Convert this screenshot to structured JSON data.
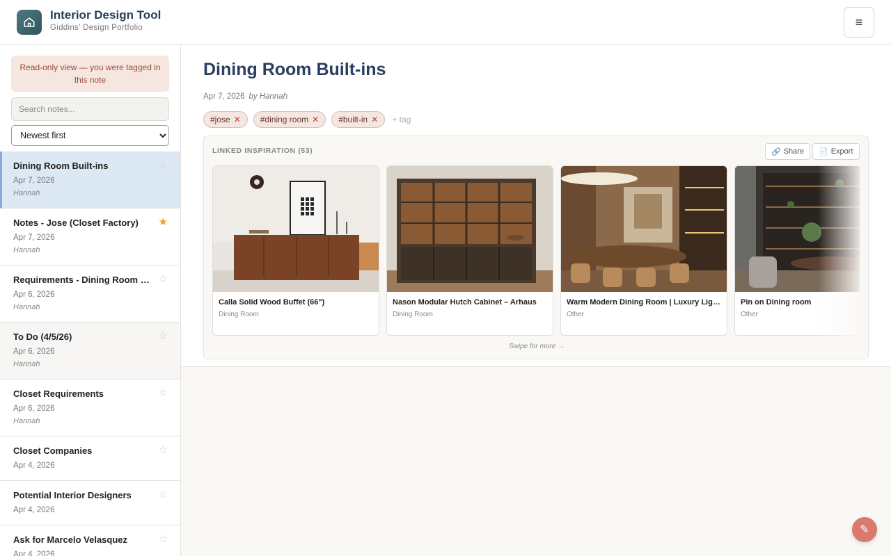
{
  "header": {
    "title": "Interior Design Tool",
    "subtitle": "Giddins' Design Portfolio",
    "logo_icon": "home-icon",
    "menu_icon": "hamburger-icon"
  },
  "sidebar": {
    "readonly_banner": "Read-only view — you were tagged in this note",
    "search_placeholder": "Search notes...",
    "sort": {
      "selected": "Newest first",
      "options": [
        "Newest first"
      ]
    },
    "notes": [
      {
        "title": "Dining Room Built-ins",
        "date": "Apr 7, 2026",
        "author": "Hannah",
        "starred": false,
        "selected": true
      },
      {
        "title": "Notes - Jose (Closet Factory)",
        "date": "Apr 7, 2026",
        "author": "Hannah",
        "starred": true,
        "selected": false
      },
      {
        "title": "Requirements - Dining Room Built-ins",
        "date": "Apr 6, 2026",
        "author": "Hannah",
        "starred": false,
        "selected": false
      },
      {
        "title": "To Do (4/5/26)",
        "date": "Apr 6, 2026",
        "author": "Hannah",
        "starred": false,
        "selected": false
      },
      {
        "title": "Closet Requirements",
        "date": "Apr 6, 2026",
        "author": "Hannah",
        "starred": false,
        "selected": false
      },
      {
        "title": "Closet Companies",
        "date": "Apr 4, 2026",
        "author": "",
        "starred": false,
        "selected": false
      },
      {
        "title": "Potential Interior Designers",
        "date": "Apr 4, 2026",
        "author": "",
        "starred": false,
        "selected": false
      },
      {
        "title": "Ask for Marcelo Velasquez",
        "date": "Apr 4, 2026",
        "author": "",
        "starred": false,
        "selected": false
      }
    ]
  },
  "main": {
    "title": "Dining Room Built-ins",
    "date": "Apr 7, 2026",
    "author": "by Hannah",
    "tags": [
      "#jose",
      "#dining room",
      "#built-in"
    ],
    "add_tag_label": "+ tag",
    "inspiration": {
      "label": "LINKED INSPIRATION (53)",
      "share_label": "Share",
      "export_label": "Export",
      "swipe_hint": "Swipe for more →",
      "cards": [
        {
          "title": "Calla Solid Wood Buffet (66\")",
          "category": "Dining Room"
        },
        {
          "title": "Nason Modular Hutch Cabinet – Arhaus",
          "category": "Dining Room"
        },
        {
          "title": "Warm Modern Dining Room | Luxury Lighting",
          "category": "Other"
        },
        {
          "title": "Pin on Dining room",
          "category": "Other"
        }
      ]
    }
  },
  "fab_icon": "sparkle-icon",
  "colors": {
    "accent": "#2b3e5f",
    "selected_bg": "#dde8f5",
    "star_on": "#f0a21b",
    "tag_bg": "#f4e6e1",
    "fab": "#d97a6c"
  }
}
